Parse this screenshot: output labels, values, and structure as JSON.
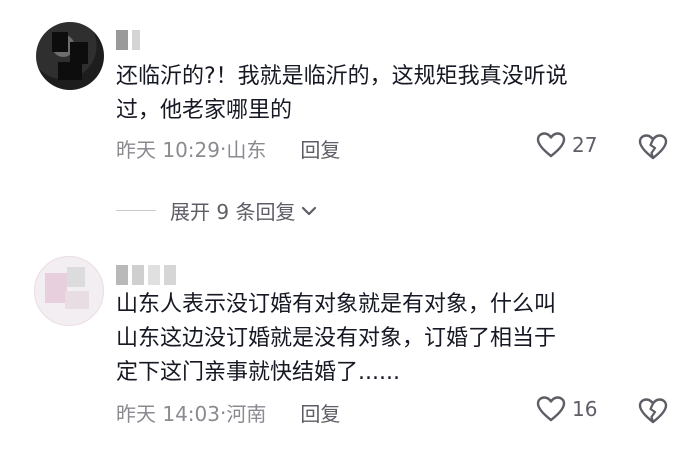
{
  "comments": [
    {
      "text_line1": "还临沂的?！我就是临沂的，这规矩我真没听说",
      "text_line2": "过，他老家哪里的",
      "time": "昨天 10:29",
      "location": "山东",
      "reply_label": "回复",
      "likes": "27"
    },
    {
      "text_line1": "山东人表示没订婚有对象就是有对象，什么叫",
      "text_line2": "山东这边没订婚就是没有对象，订婚了相当于",
      "text_line3": "定下这门亲事就快结婚了......",
      "time": "昨天 14:03",
      "location": "河南",
      "reply_label": "回复",
      "likes": "16"
    }
  ],
  "expand_replies": {
    "label": "展开 9 条回复"
  },
  "separator": "·",
  "icons": {
    "like": "heart-outline-icon",
    "dislike": "broken-heart-icon",
    "expand": "chevron-down-icon"
  },
  "colors": {
    "text": "#161823",
    "meta": "#8a8b91",
    "action": "#5d5e66"
  }
}
